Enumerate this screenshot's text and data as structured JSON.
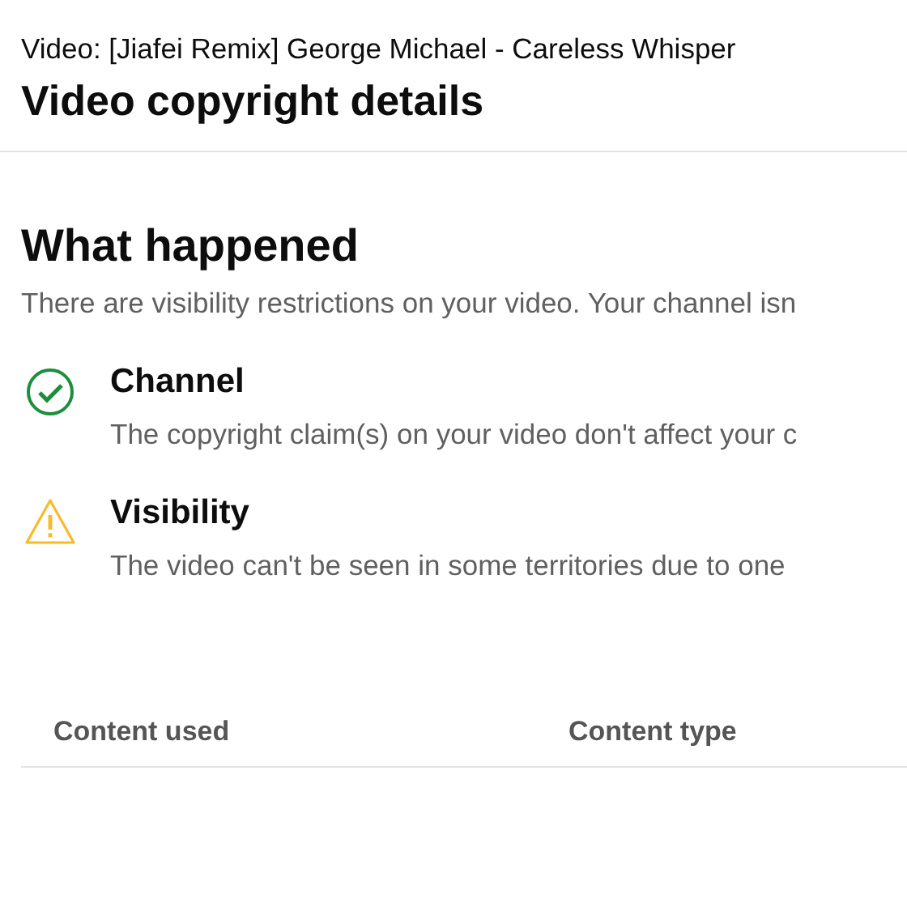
{
  "header": {
    "video_label": "Video: [Jiafei Remix] George Michael - Careless Whisper",
    "title": "Video copyright details"
  },
  "section": {
    "title": "What happened",
    "summary": "There are visibility restrictions on your video. Your channel isn"
  },
  "impacts": [
    {
      "kind": "ok",
      "title": "Channel",
      "description": "The copyright claim(s) on your video don't affect your c"
    },
    {
      "kind": "warning",
      "title": "Visibility",
      "description": "The video can't be seen in some territories due to one"
    }
  ],
  "table": {
    "columns": [
      "Content used",
      "Content type"
    ]
  }
}
